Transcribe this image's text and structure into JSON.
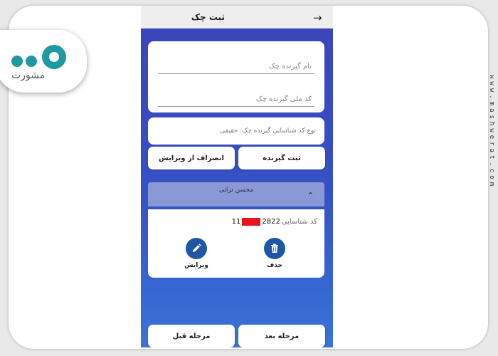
{
  "logo": {
    "text": "مشورت"
  },
  "watermark": "www.mashwerat.com",
  "screen": {
    "title": "ثبت چک",
    "back_icon": "arrow-right-icon",
    "fields": [
      {
        "label": "نام گیرنده چک"
      },
      {
        "label": "کد ملی گیرنده چک"
      }
    ],
    "receiver_type": "نوع کد شناسایی گیرنده چک: حقیقی",
    "register_button": "ثبت گیرنده",
    "cancel_edit_button": "انصراف از ویرایش",
    "receiver": {
      "name": "محسن نراتی",
      "id_label": "کد شناسایی",
      "id_start": "11",
      "id_end": "2822",
      "delete_label": "حذف",
      "edit_label": "ویرایش"
    },
    "next_button": "مرحله بعد",
    "prev_button": "مرحله قبل"
  },
  "colors": {
    "screen_gradient_top": "#3b44b8",
    "screen_gradient_bottom": "#3a73d8",
    "accordion": "#8a99d6",
    "action_circle": "#1f56a8",
    "redaction": "#e8131b",
    "logo_teal": "#1e9aa0"
  }
}
